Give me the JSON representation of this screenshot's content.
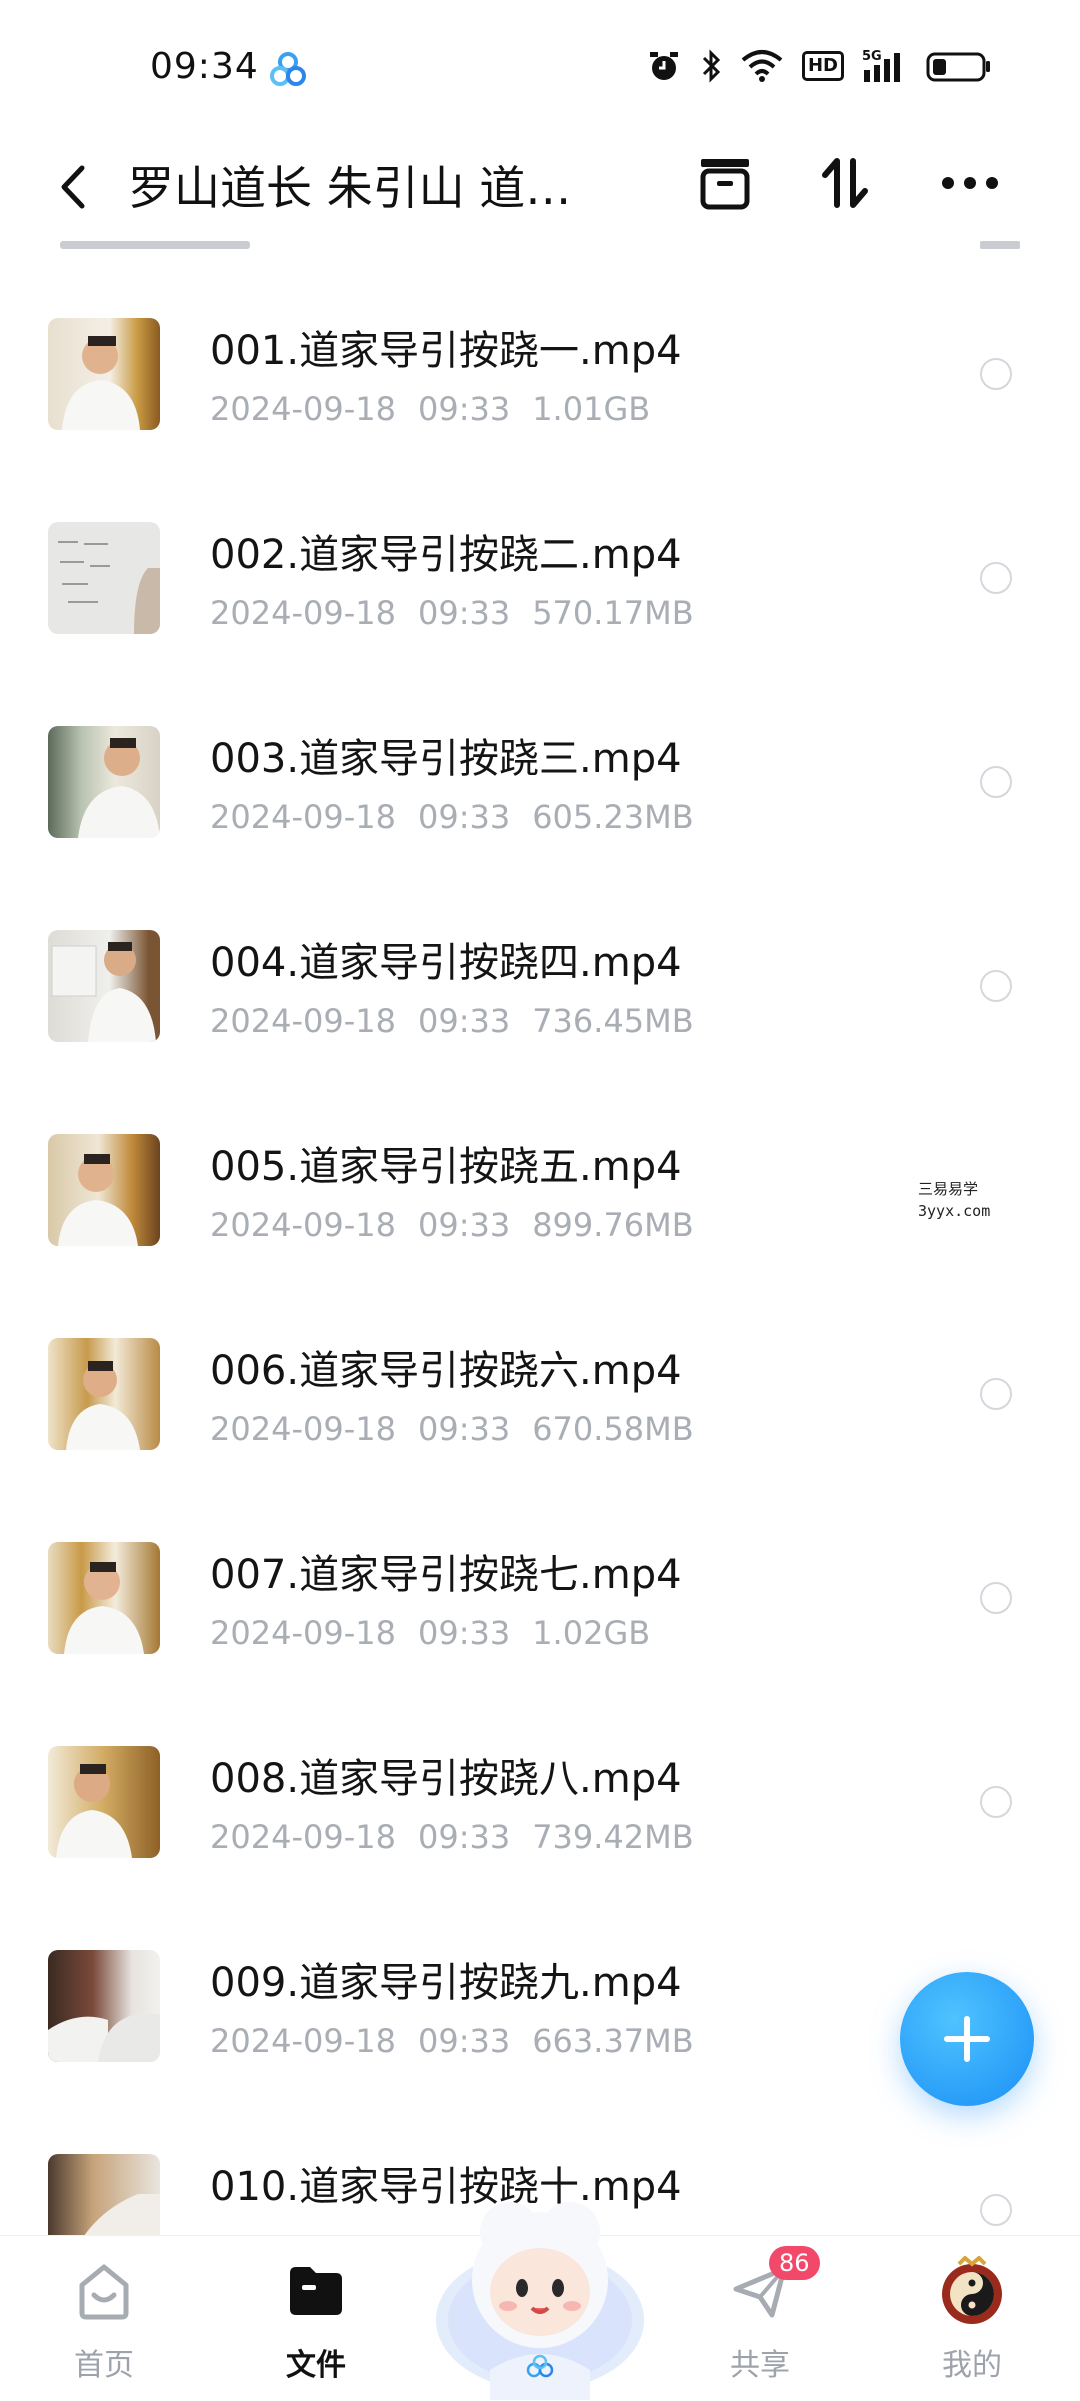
{
  "status_bar": {
    "time": "09:34",
    "hd": "HD",
    "network": "5G"
  },
  "header": {
    "title": "罗山道长 朱引山 道…"
  },
  "files": [
    {
      "name": "001.道家导引按跷一.mp4",
      "date": "2024-09-18",
      "time": "09:33",
      "size": "1.01GB"
    },
    {
      "name": "002.道家导引按跷二.mp4",
      "date": "2024-09-18",
      "time": "09:33",
      "size": "570.17MB"
    },
    {
      "name": "003.道家导引按跷三.mp4",
      "date": "2024-09-18",
      "time": "09:33",
      "size": "605.23MB"
    },
    {
      "name": "004.道家导引按跷四.mp4",
      "date": "2024-09-18",
      "time": "09:33",
      "size": "736.45MB"
    },
    {
      "name": "005.道家导引按跷五.mp4",
      "date": "2024-09-18",
      "time": "09:33",
      "size": "899.76MB"
    },
    {
      "name": "006.道家导引按跷六.mp4",
      "date": "2024-09-18",
      "time": "09:33",
      "size": "670.58MB"
    },
    {
      "name": "007.道家导引按跷七.mp4",
      "date": "2024-09-18",
      "time": "09:33",
      "size": "1.02GB"
    },
    {
      "name": "008.道家导引按跷八.mp4",
      "date": "2024-09-18",
      "time": "09:33",
      "size": "739.42MB"
    },
    {
      "name": "009.道家导引按跷九.mp4",
      "date": "2024-09-18",
      "time": "09:33",
      "size": "663.37MB"
    },
    {
      "name": "010.道家导引按跷十.mp4",
      "date": "",
      "time": "",
      "size": ""
    }
  ],
  "watermark": {
    "line1": "三易易学",
    "line2": "3yyx.com"
  },
  "bottom_nav": {
    "home": "首页",
    "files": "文件",
    "share": "共享",
    "share_badge": "86",
    "mine": "我的"
  },
  "colors": {
    "accent": "#1a8ff5",
    "badge": "#f2496a",
    "meta_text": "#a9adb4"
  }
}
